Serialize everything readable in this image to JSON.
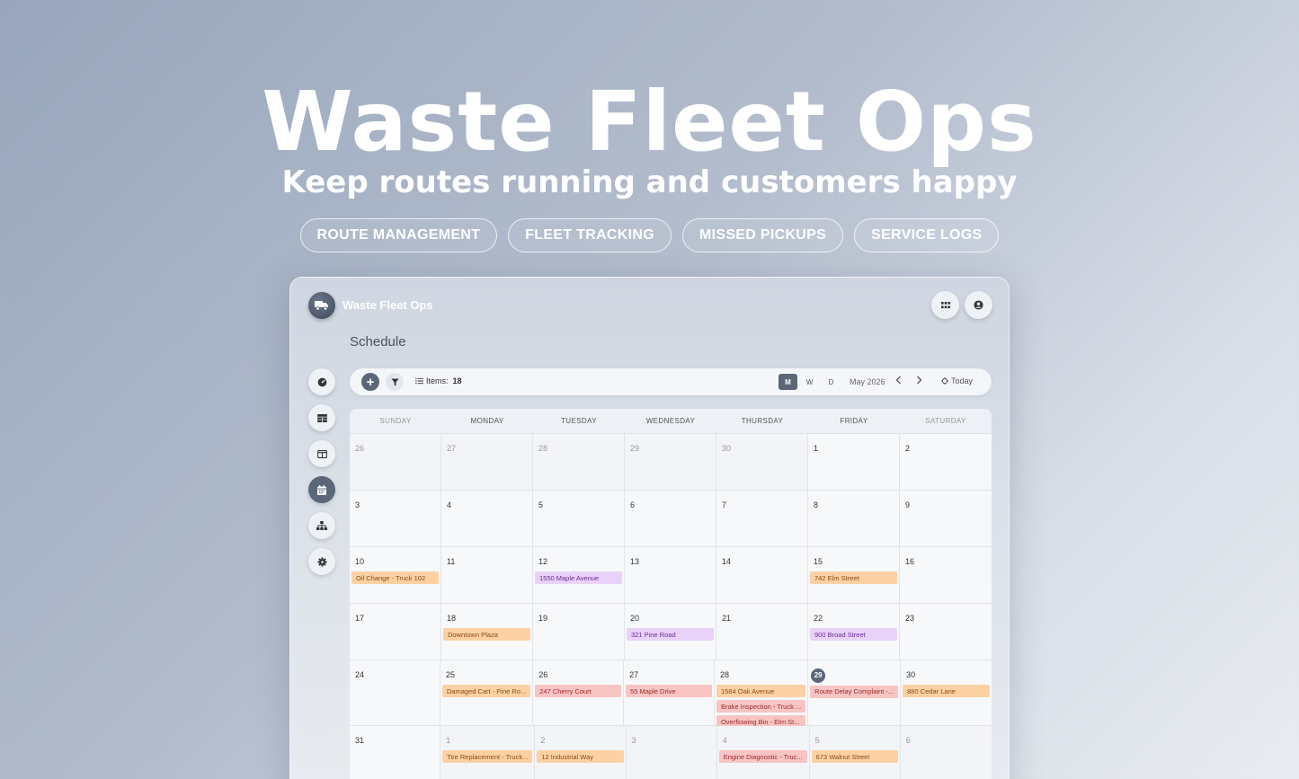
{
  "hero": {
    "title": "Waste Fleet Ops",
    "subtitle": "Keep routes running and customers happy",
    "pills": [
      "ROUTE MANAGEMENT",
      "FLEET TRACKING",
      "MISSED PICKUPS",
      "SERVICE LOGS"
    ]
  },
  "app": {
    "name": "Waste Fleet Ops",
    "page_title": "Schedule",
    "icons": {
      "logo": "truck-icon",
      "apps": "grid-icon",
      "account": "user-circle-icon",
      "sidebar": [
        "dashboard-icon",
        "table-icon",
        "columns-icon",
        "calendar-icon",
        "hierarchy-icon",
        "gear-icon"
      ]
    }
  },
  "toolbar": {
    "items_label": "Items:",
    "items_count": "18",
    "views": [
      "M",
      "W",
      "D"
    ],
    "active_view": "M",
    "month_label": "May 2026",
    "today_label": "Today"
  },
  "calendar": {
    "weekdays": [
      "SUNDAY",
      "MONDAY",
      "TUESDAY",
      "WEDNESDAY",
      "THURSDAY",
      "FRIDAY",
      "SATURDAY"
    ],
    "weeks": [
      [
        {
          "d": "26",
          "out": true
        },
        {
          "d": "27",
          "out": true
        },
        {
          "d": "28",
          "out": true
        },
        {
          "d": "29",
          "out": true
        },
        {
          "d": "30",
          "out": true
        },
        {
          "d": "1"
        },
        {
          "d": "2"
        }
      ],
      [
        {
          "d": "3"
        },
        {
          "d": "4"
        },
        {
          "d": "5"
        },
        {
          "d": "6"
        },
        {
          "d": "7"
        },
        {
          "d": "8"
        },
        {
          "d": "9"
        }
      ],
      [
        {
          "d": "10",
          "events": [
            {
              "t": "Oil Change - Truck 102",
              "c": "orange"
            }
          ]
        },
        {
          "d": "11"
        },
        {
          "d": "12",
          "events": [
            {
              "t": "1550 Maple Avenue",
              "c": "purple"
            }
          ]
        },
        {
          "d": "13"
        },
        {
          "d": "14"
        },
        {
          "d": "15",
          "events": [
            {
              "t": "742 Elm Street",
              "c": "orange"
            }
          ]
        },
        {
          "d": "16"
        }
      ],
      [
        {
          "d": "17"
        },
        {
          "d": "18",
          "events": [
            {
              "t": "Downtown Plaza",
              "c": "orange"
            }
          ]
        },
        {
          "d": "19"
        },
        {
          "d": "20",
          "events": [
            {
              "t": "321 Pine Road",
              "c": "purple"
            }
          ]
        },
        {
          "d": "21"
        },
        {
          "d": "22",
          "events": [
            {
              "t": "900 Broad Street",
              "c": "purple"
            }
          ]
        },
        {
          "d": "23"
        }
      ],
      [
        {
          "d": "24"
        },
        {
          "d": "25",
          "events": [
            {
              "t": "Damaged Cart - Pine Ro...",
              "c": "orange"
            }
          ]
        },
        {
          "d": "26",
          "events": [
            {
              "t": "247 Cherry Court",
              "c": "red"
            }
          ]
        },
        {
          "d": "27",
          "events": [
            {
              "t": "55 Maple Drive",
              "c": "red"
            }
          ]
        },
        {
          "d": "28",
          "events": [
            {
              "t": "1584 Oak Avenue",
              "c": "orange"
            },
            {
              "t": "Brake Inspection - Truck ...",
              "c": "red"
            },
            {
              "t": "Overflowing Bin - Elm St...",
              "c": "red"
            }
          ]
        },
        {
          "d": "29",
          "today": true,
          "events": [
            {
              "t": "Route Delay Complaint -...",
              "c": "red"
            }
          ]
        },
        {
          "d": "30",
          "events": [
            {
              "t": "880 Cedar Lane",
              "c": "orange"
            }
          ]
        }
      ],
      [
        {
          "d": "31"
        },
        {
          "d": "1",
          "out": true,
          "events": [
            {
              "t": "Tire Replacement - Truck...",
              "c": "orange"
            }
          ]
        },
        {
          "d": "2",
          "out": true,
          "events": [
            {
              "t": "12 Industrial Way",
              "c": "orange"
            }
          ]
        },
        {
          "d": "3",
          "out": true
        },
        {
          "d": "4",
          "out": true,
          "events": [
            {
              "t": "Engine Diagnostic - Truc...",
              "c": "red"
            }
          ]
        },
        {
          "d": "5",
          "out": true,
          "events": [
            {
              "t": "673 Walnut Street",
              "c": "orange"
            }
          ]
        },
        {
          "d": "6",
          "out": true
        }
      ]
    ]
  }
}
